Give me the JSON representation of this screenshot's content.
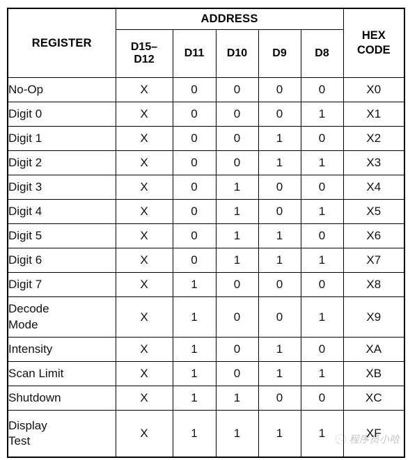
{
  "table": {
    "headers": {
      "register": "REGISTER",
      "address_group": "ADDRESS",
      "bits": [
        "D15–\nD12",
        "D11",
        "D10",
        "D9",
        "D8"
      ],
      "bit_labels": [
        "D15– D12",
        "D11",
        "D10",
        "D9",
        "D8"
      ],
      "hex_code": "HEX\nCODE",
      "hex_code_line1": "HEX",
      "hex_code_line2": "CODE"
    },
    "rows": [
      {
        "register": "No-Op",
        "register_line1": "No-Op",
        "register_line2": "",
        "bits": [
          "X",
          "0",
          "0",
          "0",
          "0"
        ],
        "hex": "X0",
        "tall": false
      },
      {
        "register": "Digit 0",
        "register_line1": "Digit 0",
        "register_line2": "",
        "bits": [
          "X",
          "0",
          "0",
          "0",
          "1"
        ],
        "hex": "X1",
        "tall": false
      },
      {
        "register": "Digit 1",
        "register_line1": "Digit 1",
        "register_line2": "",
        "bits": [
          "X",
          "0",
          "0",
          "1",
          "0"
        ],
        "hex": "X2",
        "tall": false
      },
      {
        "register": "Digit 2",
        "register_line1": "Digit 2",
        "register_line2": "",
        "bits": [
          "X",
          "0",
          "0",
          "1",
          "1"
        ],
        "hex": "X3",
        "tall": false
      },
      {
        "register": "Digit 3",
        "register_line1": "Digit 3",
        "register_line2": "",
        "bits": [
          "X",
          "0",
          "1",
          "0",
          "0"
        ],
        "hex": "X4",
        "tall": false
      },
      {
        "register": "Digit 4",
        "register_line1": "Digit 4",
        "register_line2": "",
        "bits": [
          "X",
          "0",
          "1",
          "0",
          "1"
        ],
        "hex": "X5",
        "tall": false
      },
      {
        "register": "Digit 5",
        "register_line1": "Digit 5",
        "register_line2": "",
        "bits": [
          "X",
          "0",
          "1",
          "1",
          "0"
        ],
        "hex": "X6",
        "tall": false
      },
      {
        "register": "Digit 6",
        "register_line1": "Digit 6",
        "register_line2": "",
        "bits": [
          "X",
          "0",
          "1",
          "1",
          "1"
        ],
        "hex": "X7",
        "tall": false
      },
      {
        "register": "Digit 7",
        "register_line1": "Digit 7",
        "register_line2": "",
        "bits": [
          "X",
          "1",
          "0",
          "0",
          "0"
        ],
        "hex": "X8",
        "tall": false
      },
      {
        "register": "Decode Mode",
        "register_line1": "Decode",
        "register_line2": "Mode",
        "bits": [
          "X",
          "1",
          "0",
          "0",
          "1"
        ],
        "hex": "X9",
        "tall": true
      },
      {
        "register": "Intensity",
        "register_line1": "Intensity",
        "register_line2": "",
        "bits": [
          "X",
          "1",
          "0",
          "1",
          "0"
        ],
        "hex": "XA",
        "tall": false
      },
      {
        "register": "Scan Limit",
        "register_line1": "Scan Limit",
        "register_line2": "",
        "bits": [
          "X",
          "1",
          "0",
          "1",
          "1"
        ],
        "hex": "XB",
        "tall": false
      },
      {
        "register": "Shutdown",
        "register_line1": "Shutdown",
        "register_line2": "",
        "bits": [
          "X",
          "1",
          "1",
          "0",
          "0"
        ],
        "hex": "XC",
        "tall": false
      },
      {
        "register": "Display Test",
        "register_line1": "Display",
        "register_line2": "Test",
        "bits": [
          "X",
          "1",
          "1",
          "1",
          "1"
        ],
        "hex": "XF",
        "tall": true
      }
    ]
  },
  "watermark": {
    "text": "程序员小哈",
    "logo": "wechat-circle-logo"
  },
  "colors": {
    "border": "#000000",
    "text": "#111111",
    "background": "#ffffff",
    "watermark_text": "#3a3a3a"
  }
}
